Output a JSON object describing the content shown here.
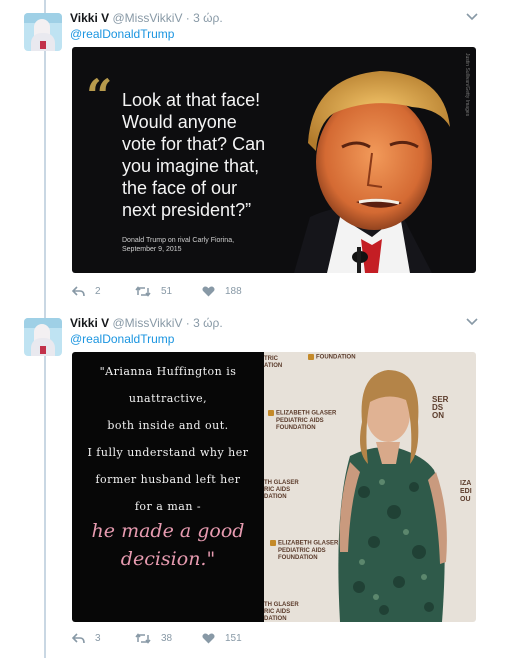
{
  "tweets": [
    {
      "name": "Vikki V",
      "handle": "@MissVikkiV",
      "time": "· 3 ώρ.",
      "mention": "@realDonaldTrump",
      "image": {
        "quote_lines": [
          "Look at that face!",
          "Would anyone",
          "vote for that? Can",
          "you imagine that,",
          "the face of our",
          "next president?”"
        ],
        "caption_lines": [
          "Donald Trump on rival Carly Fiorina,",
          "September 9, 2015"
        ]
      },
      "reply_count": "2",
      "retweet_count": "51",
      "like_count": "188"
    },
    {
      "name": "Vikki V",
      "handle": "@MissVikkiV",
      "time": "· 3 ώρ.",
      "mention": "@realDonaldTrump",
      "image": {
        "quote_lines": [
          "\"Arianna Huffington is",
          "unattractive,",
          "both inside and out.",
          "I fully understand why her",
          "former husband left her",
          "for a man -"
        ],
        "pink_lines": [
          "he made a good",
          "decision.\""
        ],
        "backdrop_text": [
          "FOUNDATION",
          "ELIZABETH GLASER",
          "PEDIATRIC AIDS",
          "FOUNDATION"
        ]
      },
      "reply_count": "3",
      "retweet_count": "38",
      "like_count": "151"
    }
  ]
}
